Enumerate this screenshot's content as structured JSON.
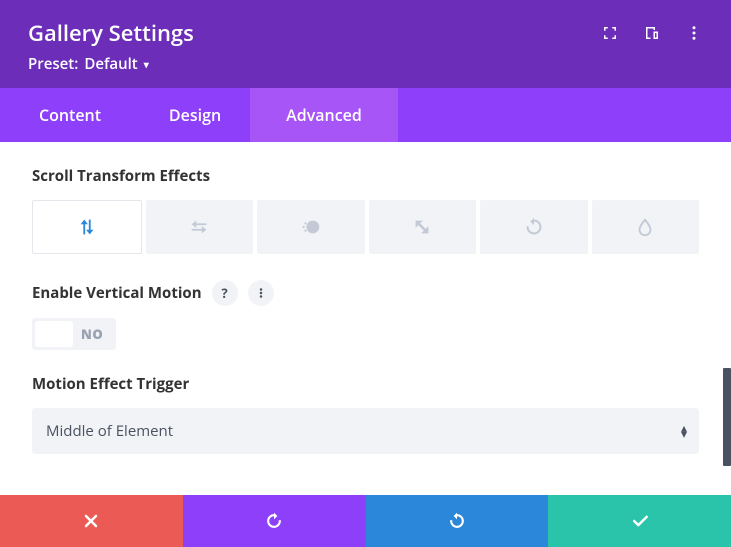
{
  "header": {
    "title": "Gallery Settings",
    "preset_label": "Preset:",
    "preset_value": "Default"
  },
  "tabs": {
    "content": "Content",
    "design": "Design",
    "advanced": "Advanced",
    "active": "Advanced"
  },
  "sections": {
    "scroll_effects_label": "Scroll Transform Effects",
    "enable_vertical_label": "Enable Vertical Motion",
    "toggle_value": "NO",
    "trigger_label": "Motion Effect Trigger",
    "trigger_value": "Middle of Element"
  },
  "effects": [
    "vertical",
    "horizontal",
    "fade",
    "rotate",
    "scale",
    "blur"
  ],
  "colors": {
    "header_bg": "#6c2eb9",
    "tabs_bg": "#8e3ff9",
    "tab_active_bg": "#a855f7",
    "cancel": "#eb5a54",
    "undo": "#8e3ff9",
    "redo": "#2b87da",
    "save": "#29c4a9"
  }
}
